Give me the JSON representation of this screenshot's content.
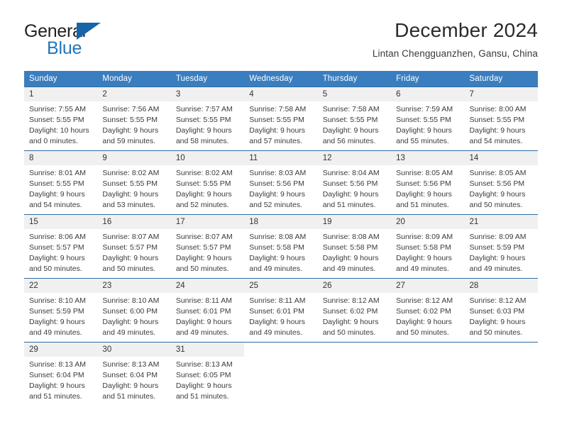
{
  "brand": {
    "name_part1": "General",
    "name_part2": "Blue",
    "flag_icon": "triangle-flag-icon"
  },
  "header": {
    "title": "December 2024",
    "subtitle": "Lintan Chengguanzhen, Gansu, China"
  },
  "colors": {
    "header_bg": "#3a7ebf",
    "row_border": "#2e6da4",
    "daynum_band": "#f0f0f0",
    "brand_blue": "#2175bd"
  },
  "labels": {
    "sunrise_prefix": "Sunrise:",
    "sunset_prefix": "Sunset:",
    "daylight_prefix": "Daylight:"
  },
  "weekdays": [
    "Sunday",
    "Monday",
    "Tuesday",
    "Wednesday",
    "Thursday",
    "Friday",
    "Saturday"
  ],
  "weeks": [
    [
      {
        "day": "1",
        "sunrise": "Sunrise: 7:55 AM",
        "sunset": "Sunset: 5:55 PM",
        "daylight1": "Daylight: 10 hours",
        "daylight2": "and 0 minutes."
      },
      {
        "day": "2",
        "sunrise": "Sunrise: 7:56 AM",
        "sunset": "Sunset: 5:55 PM",
        "daylight1": "Daylight: 9 hours",
        "daylight2": "and 59 minutes."
      },
      {
        "day": "3",
        "sunrise": "Sunrise: 7:57 AM",
        "sunset": "Sunset: 5:55 PM",
        "daylight1": "Daylight: 9 hours",
        "daylight2": "and 58 minutes."
      },
      {
        "day": "4",
        "sunrise": "Sunrise: 7:58 AM",
        "sunset": "Sunset: 5:55 PM",
        "daylight1": "Daylight: 9 hours",
        "daylight2": "and 57 minutes."
      },
      {
        "day": "5",
        "sunrise": "Sunrise: 7:58 AM",
        "sunset": "Sunset: 5:55 PM",
        "daylight1": "Daylight: 9 hours",
        "daylight2": "and 56 minutes."
      },
      {
        "day": "6",
        "sunrise": "Sunrise: 7:59 AM",
        "sunset": "Sunset: 5:55 PM",
        "daylight1": "Daylight: 9 hours",
        "daylight2": "and 55 minutes."
      },
      {
        "day": "7",
        "sunrise": "Sunrise: 8:00 AM",
        "sunset": "Sunset: 5:55 PM",
        "daylight1": "Daylight: 9 hours",
        "daylight2": "and 54 minutes."
      }
    ],
    [
      {
        "day": "8",
        "sunrise": "Sunrise: 8:01 AM",
        "sunset": "Sunset: 5:55 PM",
        "daylight1": "Daylight: 9 hours",
        "daylight2": "and 54 minutes."
      },
      {
        "day": "9",
        "sunrise": "Sunrise: 8:02 AM",
        "sunset": "Sunset: 5:55 PM",
        "daylight1": "Daylight: 9 hours",
        "daylight2": "and 53 minutes."
      },
      {
        "day": "10",
        "sunrise": "Sunrise: 8:02 AM",
        "sunset": "Sunset: 5:55 PM",
        "daylight1": "Daylight: 9 hours",
        "daylight2": "and 52 minutes."
      },
      {
        "day": "11",
        "sunrise": "Sunrise: 8:03 AM",
        "sunset": "Sunset: 5:56 PM",
        "daylight1": "Daylight: 9 hours",
        "daylight2": "and 52 minutes."
      },
      {
        "day": "12",
        "sunrise": "Sunrise: 8:04 AM",
        "sunset": "Sunset: 5:56 PM",
        "daylight1": "Daylight: 9 hours",
        "daylight2": "and 51 minutes."
      },
      {
        "day": "13",
        "sunrise": "Sunrise: 8:05 AM",
        "sunset": "Sunset: 5:56 PM",
        "daylight1": "Daylight: 9 hours",
        "daylight2": "and 51 minutes."
      },
      {
        "day": "14",
        "sunrise": "Sunrise: 8:05 AM",
        "sunset": "Sunset: 5:56 PM",
        "daylight1": "Daylight: 9 hours",
        "daylight2": "and 50 minutes."
      }
    ],
    [
      {
        "day": "15",
        "sunrise": "Sunrise: 8:06 AM",
        "sunset": "Sunset: 5:57 PM",
        "daylight1": "Daylight: 9 hours",
        "daylight2": "and 50 minutes."
      },
      {
        "day": "16",
        "sunrise": "Sunrise: 8:07 AM",
        "sunset": "Sunset: 5:57 PM",
        "daylight1": "Daylight: 9 hours",
        "daylight2": "and 50 minutes."
      },
      {
        "day": "17",
        "sunrise": "Sunrise: 8:07 AM",
        "sunset": "Sunset: 5:57 PM",
        "daylight1": "Daylight: 9 hours",
        "daylight2": "and 50 minutes."
      },
      {
        "day": "18",
        "sunrise": "Sunrise: 8:08 AM",
        "sunset": "Sunset: 5:58 PM",
        "daylight1": "Daylight: 9 hours",
        "daylight2": "and 49 minutes."
      },
      {
        "day": "19",
        "sunrise": "Sunrise: 8:08 AM",
        "sunset": "Sunset: 5:58 PM",
        "daylight1": "Daylight: 9 hours",
        "daylight2": "and 49 minutes."
      },
      {
        "day": "20",
        "sunrise": "Sunrise: 8:09 AM",
        "sunset": "Sunset: 5:58 PM",
        "daylight1": "Daylight: 9 hours",
        "daylight2": "and 49 minutes."
      },
      {
        "day": "21",
        "sunrise": "Sunrise: 8:09 AM",
        "sunset": "Sunset: 5:59 PM",
        "daylight1": "Daylight: 9 hours",
        "daylight2": "and 49 minutes."
      }
    ],
    [
      {
        "day": "22",
        "sunrise": "Sunrise: 8:10 AM",
        "sunset": "Sunset: 5:59 PM",
        "daylight1": "Daylight: 9 hours",
        "daylight2": "and 49 minutes."
      },
      {
        "day": "23",
        "sunrise": "Sunrise: 8:10 AM",
        "sunset": "Sunset: 6:00 PM",
        "daylight1": "Daylight: 9 hours",
        "daylight2": "and 49 minutes."
      },
      {
        "day": "24",
        "sunrise": "Sunrise: 8:11 AM",
        "sunset": "Sunset: 6:01 PM",
        "daylight1": "Daylight: 9 hours",
        "daylight2": "and 49 minutes."
      },
      {
        "day": "25",
        "sunrise": "Sunrise: 8:11 AM",
        "sunset": "Sunset: 6:01 PM",
        "daylight1": "Daylight: 9 hours",
        "daylight2": "and 49 minutes."
      },
      {
        "day": "26",
        "sunrise": "Sunrise: 8:12 AM",
        "sunset": "Sunset: 6:02 PM",
        "daylight1": "Daylight: 9 hours",
        "daylight2": "and 50 minutes."
      },
      {
        "day": "27",
        "sunrise": "Sunrise: 8:12 AM",
        "sunset": "Sunset: 6:02 PM",
        "daylight1": "Daylight: 9 hours",
        "daylight2": "and 50 minutes."
      },
      {
        "day": "28",
        "sunrise": "Sunrise: 8:12 AM",
        "sunset": "Sunset: 6:03 PM",
        "daylight1": "Daylight: 9 hours",
        "daylight2": "and 50 minutes."
      }
    ],
    [
      {
        "day": "29",
        "sunrise": "Sunrise: 8:13 AM",
        "sunset": "Sunset: 6:04 PM",
        "daylight1": "Daylight: 9 hours",
        "daylight2": "and 51 minutes."
      },
      {
        "day": "30",
        "sunrise": "Sunrise: 8:13 AM",
        "sunset": "Sunset: 6:04 PM",
        "daylight1": "Daylight: 9 hours",
        "daylight2": "and 51 minutes."
      },
      {
        "day": "31",
        "sunrise": "Sunrise: 8:13 AM",
        "sunset": "Sunset: 6:05 PM",
        "daylight1": "Daylight: 9 hours",
        "daylight2": "and 51 minutes."
      },
      {
        "day": "",
        "sunrise": "",
        "sunset": "",
        "daylight1": "",
        "daylight2": ""
      },
      {
        "day": "",
        "sunrise": "",
        "sunset": "",
        "daylight1": "",
        "daylight2": ""
      },
      {
        "day": "",
        "sunrise": "",
        "sunset": "",
        "daylight1": "",
        "daylight2": ""
      },
      {
        "day": "",
        "sunrise": "",
        "sunset": "",
        "daylight1": "",
        "daylight2": ""
      }
    ]
  ]
}
